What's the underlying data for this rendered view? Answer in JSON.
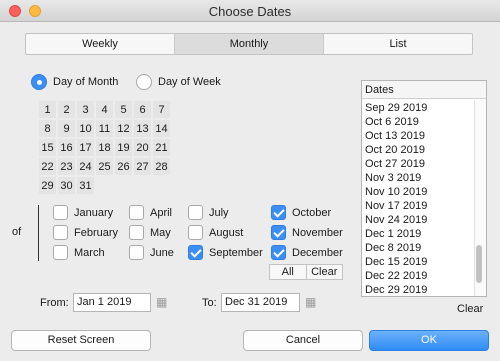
{
  "window": {
    "title": "Choose Dates"
  },
  "tabs": [
    "Weekly",
    "Monthly",
    "List"
  ],
  "mode": {
    "day_of_month": "Day of Month",
    "day_of_week": "Day of Week"
  },
  "days": [
    "1",
    "2",
    "3",
    "4",
    "5",
    "6",
    "7",
    "8",
    "9",
    "10",
    "11",
    "12",
    "13",
    "14",
    "15",
    "16",
    "17",
    "18",
    "19",
    "20",
    "21",
    "22",
    "23",
    "24",
    "25",
    "26",
    "27",
    "28",
    "29",
    "30",
    "31"
  ],
  "of_label": "of",
  "months": [
    {
      "label": "January",
      "checked": false
    },
    {
      "label": "February",
      "checked": false
    },
    {
      "label": "March",
      "checked": false
    },
    {
      "label": "April",
      "checked": false
    },
    {
      "label": "May",
      "checked": false
    },
    {
      "label": "June",
      "checked": false
    },
    {
      "label": "July",
      "checked": false
    },
    {
      "label": "August",
      "checked": false
    },
    {
      "label": "September",
      "checked": true
    },
    {
      "label": "October",
      "checked": true
    },
    {
      "label": "November",
      "checked": true
    },
    {
      "label": "December",
      "checked": true
    }
  ],
  "month_buttons": {
    "all": "All",
    "clear": "Clear"
  },
  "range": {
    "from_label": "From:",
    "from_value": "Jan 1 2019",
    "to_label": "To:",
    "to_value": "Dec 31 2019"
  },
  "dates_panel": {
    "header": "Dates",
    "items": [
      "Sep 29 2019",
      "Oct 6 2019",
      "Oct 13 2019",
      "Oct 20 2019",
      "Oct 27 2019",
      "Nov 3 2019",
      "Nov 10 2019",
      "Nov 17 2019",
      "Nov 24 2019",
      "Dec 1 2019",
      "Dec 8 2019",
      "Dec 15 2019",
      "Dec 22 2019",
      "Dec 29 2019"
    ],
    "clear": "Clear"
  },
  "buttons": {
    "reset": "Reset Screen",
    "cancel": "Cancel",
    "ok": "OK"
  }
}
